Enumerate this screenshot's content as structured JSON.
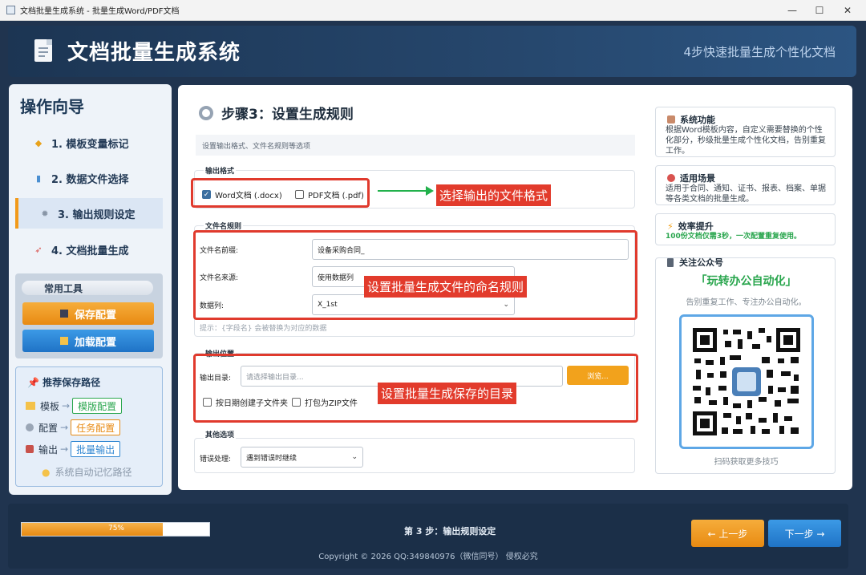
{
  "window": {
    "title": "文档批量生成系统 - 批量生成Word/PDF文档",
    "minimize": "—",
    "maximize": "☐",
    "close": "✕"
  },
  "header": {
    "title": "文档批量生成系统",
    "subtitle": "4步快速批量生成个性化文档"
  },
  "sidebar": {
    "title": "操作向导",
    "steps": [
      {
        "label": "1. 模板变量标记",
        "icon": "tag-icon"
      },
      {
        "label": "2. 数据文件选择",
        "icon": "chart-icon"
      },
      {
        "label": "3. 输出规则设定",
        "icon": "gear-icon",
        "active": true
      },
      {
        "label": "4. 文档批量生成",
        "icon": "rocket-icon"
      }
    ],
    "tools": {
      "title": "常用工具",
      "save_label": "保存配置",
      "load_label": "加载配置"
    },
    "paths": {
      "title": "推荐保存路径",
      "rows": [
        {
          "label": "模板",
          "tag": "模版配置",
          "color": "#2aa64e"
        },
        {
          "label": "配置",
          "tag": "任务配置",
          "color": "#e88a12"
        },
        {
          "label": "输出",
          "tag": "批量输出",
          "color": "#2f86d2"
        }
      ],
      "tip": "系统自动记忆路径"
    }
  },
  "main": {
    "step_title": "步骤3：设置生成规则",
    "step_desc": "设置输出格式、文件名规则等选项",
    "output_format": {
      "label": "输出格式",
      "word": {
        "label": "Word文档 (.docx)",
        "checked": true
      },
      "pdf": {
        "label": "PDF文档 (.pdf)",
        "checked": false
      }
    },
    "filename_rule": {
      "label": "文件名规则",
      "prefix_label": "文件名前缀:",
      "prefix_value": "设备采购合同_",
      "source_label": "文件名来源:",
      "source_value": "使用数据列",
      "column_label": "数据列:",
      "column_value": "X_1st",
      "hint": "提示：{字段名} 会被替换为对应的数据"
    },
    "output_location": {
      "label": "输出位置",
      "dir_label": "输出目录:",
      "dir_placeholder": "请选择输出目录...",
      "browse_label": "浏览...",
      "by_date_label": "按日期创建子文件夹",
      "zip_label": "打包为ZIP文件"
    },
    "other": {
      "label": "其他选项",
      "error_label": "错误处理:",
      "error_value": "遇到错误时继续"
    },
    "annotations": {
      "format_note": "选择输出的文件格式",
      "naming_note": "设置批量生成文件的命名规则",
      "dir_note": "设置批量生成保存的目录",
      "color": "#e03a2d"
    },
    "info": {
      "features_title": "系统功能",
      "features_text": "根据Word模板内容，自定义需要替换的个性化部分，秒级批量生成个性化文档，告别重复工作。",
      "scenes_title": "适用场景",
      "scenes_text": "适用于合同、通知、证书、报表、档案、单据等各类文档的批量生成。",
      "efficiency_title": "效率提升",
      "efficiency_text": "100份文档仅需3秒，一次配置重复使用。",
      "wechat_title": "关注公众号",
      "wechat_slogan": "「玩转办公自动化」",
      "wechat_sub": "告别重复工作、专注办公自动化。",
      "qr_foot": "扫码获取更多技巧"
    }
  },
  "footer": {
    "progress": 0.75,
    "progress_text": "75%",
    "status": "第 3 步：输出规则设定",
    "prev_label": "← 上一步",
    "next_label": "下一步 →",
    "copyright": "Copyright © 2026 QQ:349840976（微信同号） 侵权必究"
  }
}
